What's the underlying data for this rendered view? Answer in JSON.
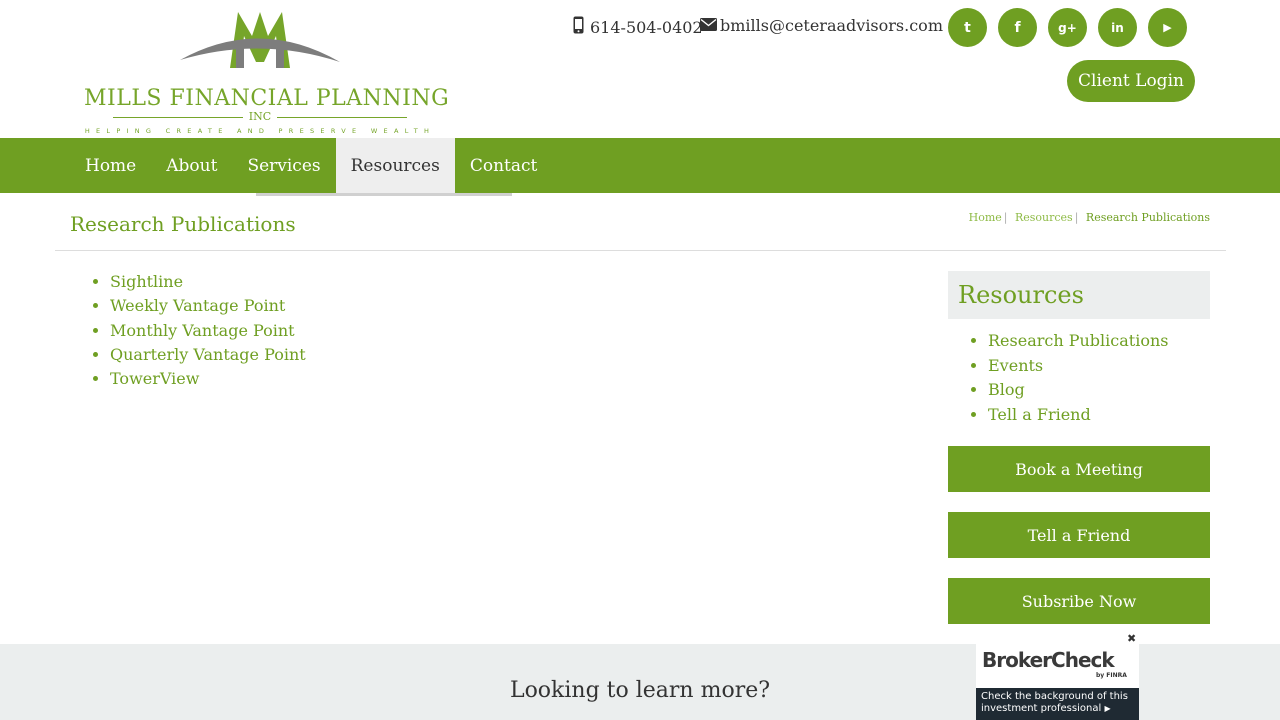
{
  "logo": {
    "name": "MILLS FINANCIAL PLANNING",
    "inc": "INC",
    "tagline": "HELPING CREATE AND PRESERVE WEALTH"
  },
  "contact": {
    "phone": "614-504-0402",
    "email": "bmills@ceteraadvisors.com"
  },
  "social": [
    {
      "icon": "twitter-icon",
      "glyph": "t"
    },
    {
      "icon": "facebook-icon",
      "glyph": "f"
    },
    {
      "icon": "google-plus-icon",
      "glyph": "g+"
    },
    {
      "icon": "linkedin-icon",
      "glyph": "in"
    },
    {
      "icon": "youtube-icon",
      "glyph": "▶"
    }
  ],
  "client_login": "Client Login",
  "nav": {
    "items": [
      {
        "label": "Home"
      },
      {
        "label": "About"
      },
      {
        "label": "Services"
      },
      {
        "label": "Resources",
        "active": true
      },
      {
        "label": "Contact"
      }
    ]
  },
  "page": {
    "title": "Research Publications",
    "breadcrumb": [
      "Home",
      "Resources",
      "Research Publications"
    ]
  },
  "publications": [
    "Sightline",
    "Weekly Vantage Point",
    "Monthly Vantage Point",
    "Quarterly Vantage Point",
    "TowerView"
  ],
  "sidebar": {
    "heading": "Resources",
    "links": [
      "Research Publications",
      "Events",
      "Blog",
      "Tell a Friend"
    ],
    "buttons": [
      "Book a Meeting",
      "Tell a Friend",
      "Subsribe Now"
    ]
  },
  "footer": {
    "question": "Looking to learn more?"
  },
  "brokercheck": {
    "logo_text": "BrokerCheck",
    "by": "by FINRA",
    "line1": "Check the background of this",
    "line2": "investment professional",
    "close": "✖"
  },
  "colors": {
    "brand_green": "#6f9f22",
    "nav_active_bg": "#eeeeee",
    "footer_bg": "#ebeeee"
  }
}
